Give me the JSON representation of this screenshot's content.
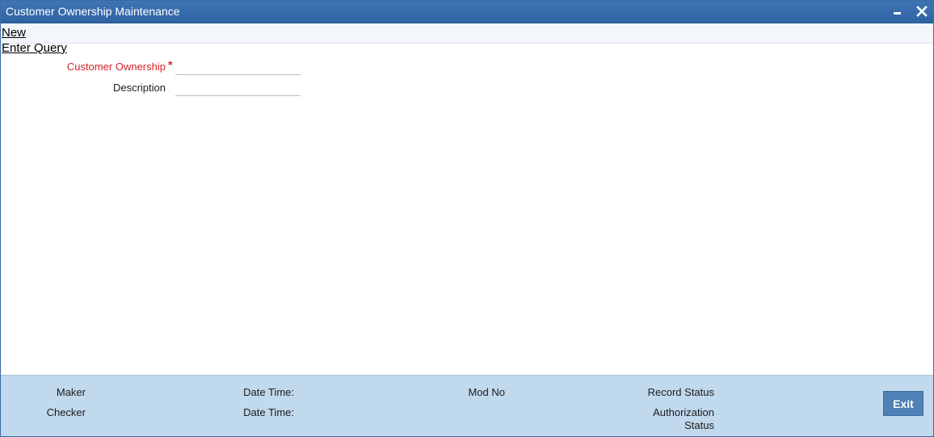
{
  "window": {
    "title": "Customer Ownership Maintenance",
    "minimize_icon": "minimize-icon",
    "close_icon": "close-icon"
  },
  "toolbar": {
    "new_label": "New",
    "enter_query_label": "Enter Query"
  },
  "form": {
    "customer_ownership_label": "Customer Ownership",
    "required_mark": "*",
    "customer_ownership_value": "",
    "description_label": "Description",
    "description_value": ""
  },
  "footer": {
    "maker_label": "Maker",
    "checker_label": "Checker",
    "maker_date_time_label": "Date Time:",
    "checker_date_time_label": "Date Time:",
    "mod_no_label": "Mod No",
    "record_status_label": "Record Status",
    "authorization_label": "Authorization",
    "status_label": "Status",
    "exit_label": "Exit"
  },
  "colors": {
    "titlebar": "#3f75b5",
    "footer": "#c1d9ed",
    "required": "#d4232b",
    "exit_button": "#4f81b6"
  }
}
